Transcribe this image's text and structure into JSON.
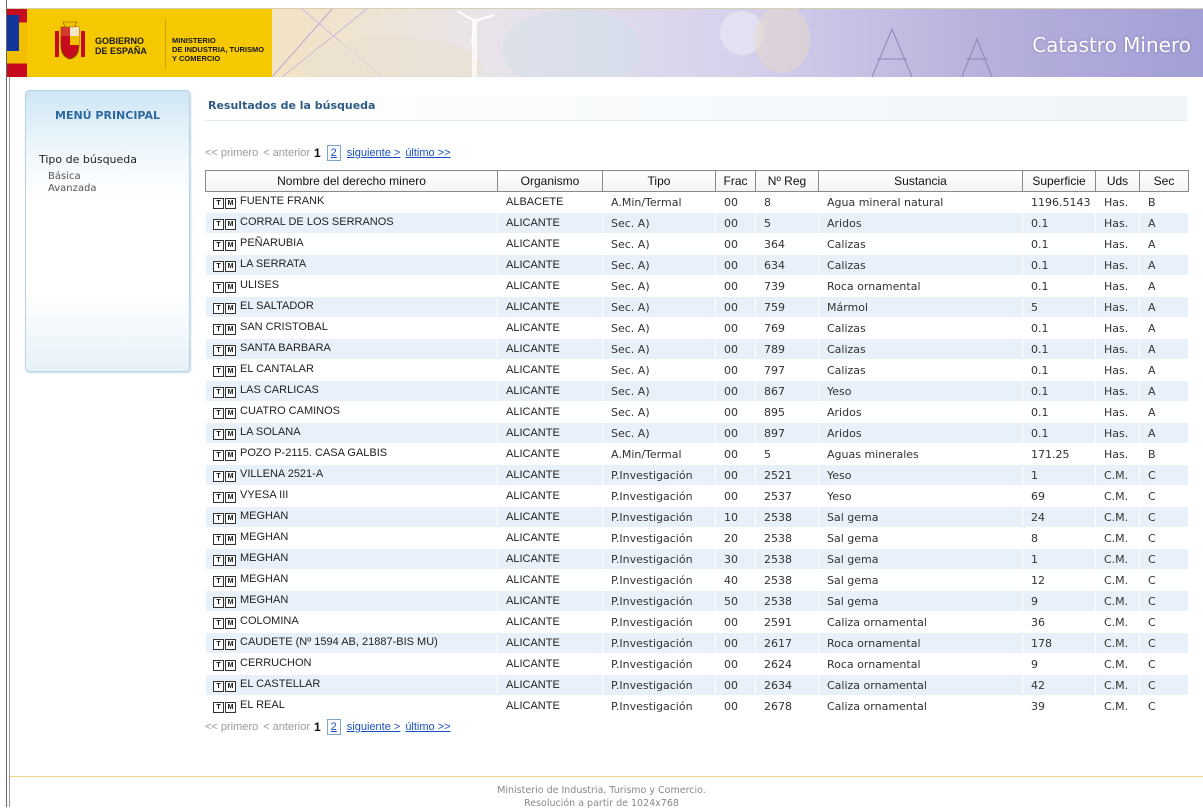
{
  "header": {
    "gobierno": [
      "GOBIERNO",
      "DE ESPAÑA"
    ],
    "ministerio": [
      "MINISTERIO",
      "DE INDUSTRIA, TURISMO",
      "Y COMERCIO"
    ],
    "site_title": "Catastro Minero"
  },
  "sidebar": {
    "menu_title": "MENÚ PRINCIPAL",
    "search_type_label": "Tipo de búsqueda",
    "items": [
      {
        "label": "Básica"
      },
      {
        "label": "Avanzada"
      }
    ]
  },
  "main": {
    "heading": "Resultados de la búsqueda"
  },
  "pager": {
    "first": "<< primero",
    "prev": "< anterior",
    "current": "1",
    "page2": "2",
    "next": "siguiente >",
    "last": "último >>"
  },
  "table": {
    "row_icons": [
      "T",
      "M"
    ],
    "columns": [
      "Nombre del derecho minero",
      "Organismo",
      "Tipo",
      "Frac",
      "Nº Reg",
      "Sustancia",
      "Superficie",
      "Uds",
      "Sec"
    ],
    "rows": [
      [
        "FUENTE FRANK",
        "ALBACETE",
        "A.Min/Termal",
        "00",
        "8",
        "Agua mineral natural",
        "1196.5143",
        "Has.",
        "B"
      ],
      [
        "CORRAL DE LOS SERRANOS",
        "ALICANTE",
        "Sec. A)",
        "00",
        "5",
        "Aridos",
        "0.1",
        "Has.",
        "A"
      ],
      [
        "PEÑARUBIA",
        "ALICANTE",
        "Sec. A)",
        "00",
        "364",
        "Calizas",
        "0.1",
        "Has.",
        "A"
      ],
      [
        "LA SERRATA",
        "ALICANTE",
        "Sec. A)",
        "00",
        "634",
        "Calizas",
        "0.1",
        "Has.",
        "A"
      ],
      [
        "ULISES",
        "ALICANTE",
        "Sec. A)",
        "00",
        "739",
        "Roca ornamental",
        "0.1",
        "Has.",
        "A"
      ],
      [
        "EL SALTADOR",
        "ALICANTE",
        "Sec. A)",
        "00",
        "759",
        "Mármol",
        "5",
        "Has.",
        "A"
      ],
      [
        "SAN CRISTOBAL",
        "ALICANTE",
        "Sec. A)",
        "00",
        "769",
        "Calizas",
        "0.1",
        "Has.",
        "A"
      ],
      [
        "SANTA BARBARA",
        "ALICANTE",
        "Sec. A)",
        "00",
        "789",
        "Calizas",
        "0.1",
        "Has.",
        "A"
      ],
      [
        "EL CANTALAR",
        "ALICANTE",
        "Sec. A)",
        "00",
        "797",
        "Calizas",
        "0.1",
        "Has.",
        "A"
      ],
      [
        "LAS CARLICAS",
        "ALICANTE",
        "Sec. A)",
        "00",
        "867",
        "Yeso",
        "0.1",
        "Has.",
        "A"
      ],
      [
        "CUATRO CAMINOS",
        "ALICANTE",
        "Sec. A)",
        "00",
        "895",
        "Aridos",
        "0.1",
        "Has.",
        "A"
      ],
      [
        "LA SOLANA",
        "ALICANTE",
        "Sec. A)",
        "00",
        "897",
        "Aridos",
        "0.1",
        "Has.",
        "A"
      ],
      [
        "POZO P-2115. CASA GALBIS",
        "ALICANTE",
        "A.Min/Termal",
        "00",
        "5",
        "Aguas minerales",
        "171.25",
        "Has.",
        "B"
      ],
      [
        "VILLENA 2521-A",
        "ALICANTE",
        "P.Investigación",
        "00",
        "2521",
        "Yeso",
        "1",
        "C.M.",
        "C"
      ],
      [
        "VYESA III",
        "ALICANTE",
        "P.Investigación",
        "00",
        "2537",
        "Yeso",
        "69",
        "C.M.",
        "C"
      ],
      [
        "MEGHAN",
        "ALICANTE",
        "P.Investigación",
        "10",
        "2538",
        "Sal gema",
        "24",
        "C.M.",
        "C"
      ],
      [
        "MEGHAN",
        "ALICANTE",
        "P.Investigación",
        "20",
        "2538",
        "Sal gema",
        "8",
        "C.M.",
        "C"
      ],
      [
        "MEGHAN",
        "ALICANTE",
        "P.Investigación",
        "30",
        "2538",
        "Sal gema",
        "1",
        "C.M.",
        "C"
      ],
      [
        "MEGHAN",
        "ALICANTE",
        "P.Investigación",
        "40",
        "2538",
        "Sal gema",
        "12",
        "C.M.",
        "C"
      ],
      [
        "MEGHAN",
        "ALICANTE",
        "P.Investigación",
        "50",
        "2538",
        "Sal gema",
        "9",
        "C.M.",
        "C"
      ],
      [
        "COLOMINA",
        "ALICANTE",
        "P.Investigación",
        "00",
        "2591",
        "Caliza ornamental",
        "36",
        "C.M.",
        "C"
      ],
      [
        "CAUDETE (Nº 1594 AB, 21887-BIS MU)",
        "ALICANTE",
        "P.Investigación",
        "00",
        "2617",
        "Roca ornamental",
        "178",
        "C.M.",
        "C"
      ],
      [
        "CERRUCHON",
        "ALICANTE",
        "P.Investigación",
        "00",
        "2624",
        "Roca ornamental",
        "9",
        "C.M.",
        "C"
      ],
      [
        "EL CASTELLAR",
        "ALICANTE",
        "P.Investigación",
        "00",
        "2634",
        "Caliza ornamental",
        "42",
        "C.M.",
        "C"
      ],
      [
        "EL REAL",
        "ALICANTE",
        "P.Investigación",
        "00",
        "2678",
        "Caliza ornamental",
        "39",
        "C.M.",
        "C"
      ]
    ]
  },
  "footer": {
    "line1": "Ministerio de Industria, Turismo y Comercio.",
    "line2": "Resolución a partir de 1024x768"
  },
  "colors": {
    "accent_link": "#1a4fc0",
    "heading": "#2d5b84",
    "row_alt": "#e8f1f9",
    "brand_yellow": "#f5c800"
  }
}
